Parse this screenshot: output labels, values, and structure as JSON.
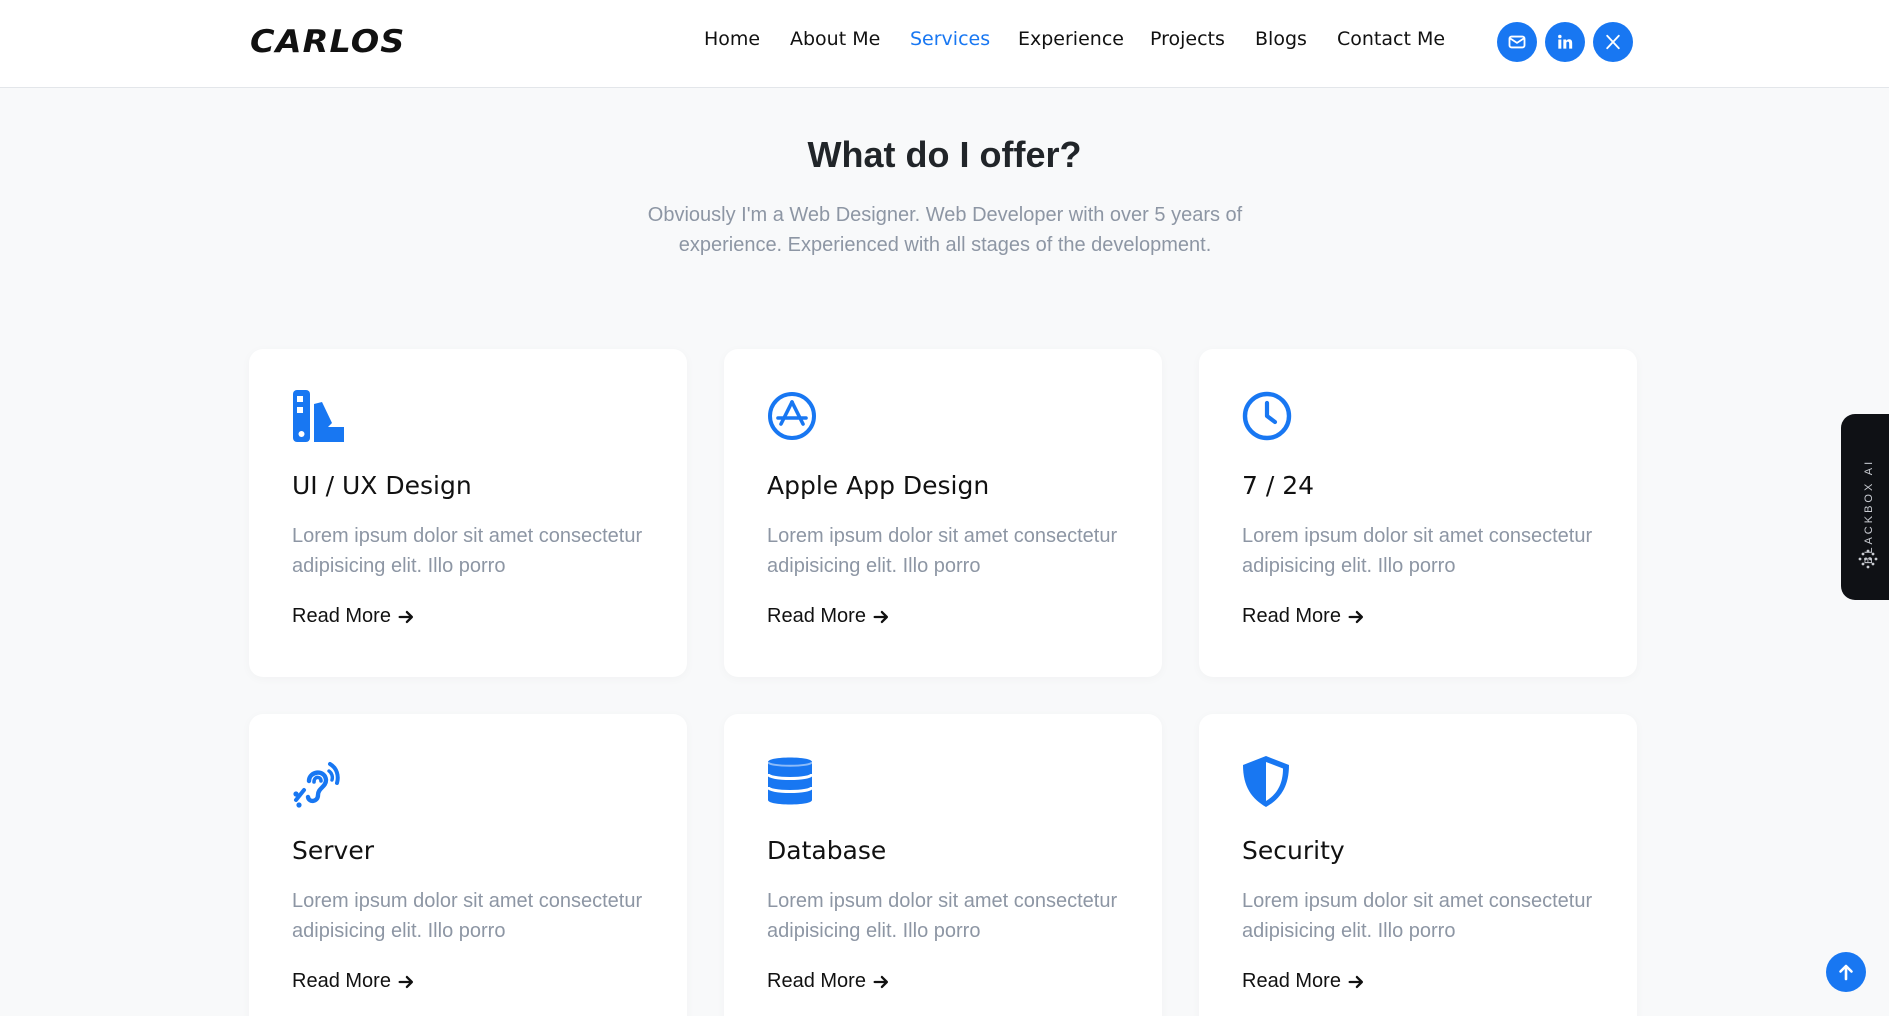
{
  "brand": {
    "logo_text": "CARLOS"
  },
  "nav": {
    "items": [
      {
        "label": "Home"
      },
      {
        "label": "About Me"
      },
      {
        "label": "Services"
      },
      {
        "label": "Experience"
      },
      {
        "label": "Projects"
      },
      {
        "label": "Blogs"
      },
      {
        "label": "Contact Me"
      }
    ],
    "active": "Services",
    "social_icons": [
      "email-icon",
      "linkedin-icon",
      "x-icon"
    ]
  },
  "section": {
    "title": "What do I offer?",
    "subtitle_line1": "Obviously I'm a Web Designer. Web Developer with over 5 years of",
    "subtitle_line2": "experience. Experienced with all stages of the development."
  },
  "services": [
    {
      "icon": "swatchbook-icon",
      "title": "UI / UX Design",
      "text_line1": "Lorem ipsum dolor sit amet consectetur",
      "text_line2": "adipisicing elit. Illo porro",
      "link": "Read More"
    },
    {
      "icon": "app-store-icon",
      "title": "Apple App Design",
      "text_line1": "Lorem ipsum dolor sit amet consectetur",
      "text_line2": "adipisicing elit. Illo porro",
      "link": "Read More"
    },
    {
      "icon": "clock-icon",
      "title": "7 / 24",
      "text_line1": "Lorem ipsum dolor sit amet consectetur",
      "text_line2": "adipisicing elit. Illo porro",
      "link": "Read More"
    },
    {
      "icon": "ear-listen-icon",
      "title": "Server",
      "text_line1": "Lorem ipsum dolor sit amet consectetur",
      "text_line2": "adipisicing elit. Illo porro",
      "link": "Read More"
    },
    {
      "icon": "database-icon",
      "title": "Database",
      "text_line1": "Lorem ipsum dolor sit amet consectetur",
      "text_line2": "adipisicing elit. Illo porro",
      "link": "Read More"
    },
    {
      "icon": "shield-icon",
      "title": "Security",
      "text_line1": "Lorem ipsum dolor sit amet consectetur",
      "text_line2": "adipisicing elit. Illo porro",
      "link": "Read More"
    }
  ],
  "side_widget": {
    "label": "BLACKBOX AI"
  },
  "colors": {
    "accent": "#1877f2",
    "muted_text": "#8d96a4",
    "background": "#f8f9fa"
  }
}
